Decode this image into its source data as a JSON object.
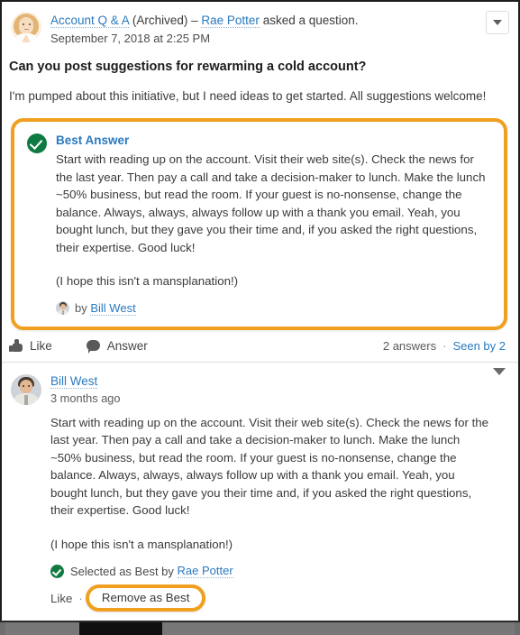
{
  "question": {
    "group_name": "Account Q & A",
    "archived_label": "(Archived)",
    "separator": "–",
    "author": "Rae Potter",
    "action_text": "asked a question.",
    "timestamp": "September 7, 2018 at 2:25 PM",
    "title": "Can you post suggestions for rewarming a cold account?",
    "body": "I'm pumped about this initiative, but I need ideas to get started. All suggestions welcome!",
    "menu_icon": "chevron-down-icon"
  },
  "best_answer": {
    "check_icon": "check-circle-icon",
    "label": "Best Answer",
    "paragraph1": "Start with reading up on the account. Visit their web site(s). Check the news for the last year. Then pay a call and take a decision-maker to lunch. Make the lunch ~50% business, but read the room. If your guest is no-nonsense, change the balance. Always, always, always follow up with a thank you email. Yeah, you bought lunch, but they gave you their time and, if you asked the right questions, their expertise. Good luck!",
    "paragraph2": "(I hope this isn't a mansplanation!)",
    "by_prefix": "by",
    "by_author": "Bill West",
    "border_color": "#F0A01E",
    "check_color": "#107A43"
  },
  "action_bar": {
    "like_label": "Like",
    "like_icon": "thumbs-up-icon",
    "answer_label": "Answer",
    "answer_icon": "comment-bubble-icon",
    "answers_count": "2 answers",
    "separator": "·",
    "seen_by": "Seen by 2"
  },
  "answer": {
    "author": "Bill West",
    "timestamp": "3 months ago",
    "menu_icon": "chevron-down-icon",
    "paragraph1": "Start with reading up on the account. Visit their web site(s). Check the news for the last year. Then pay a call and take a decision-maker to lunch. Make the lunch ~50% business, but read the room. If your guest is no-nonsense, change the balance. Always, always, always follow up with a thank you email. Yeah, you bought lunch, but they gave you their time and, if you asked the right questions, their expertise. Good luck!",
    "paragraph2": "(I hope this isn't a mansplanation!)",
    "selected_prefix": "Selected as Best by",
    "selected_by": "Rae Potter",
    "selected_icon": "check-circle-icon",
    "like_label": "Like",
    "separator": "·",
    "remove_as_best_label": "Remove as Best",
    "highlight_color": "#F0A01E"
  },
  "colors": {
    "link": "#2A7ABF",
    "accent_orange": "#F0A01E",
    "success_green": "#107A43",
    "text": "#3A3A3A"
  }
}
